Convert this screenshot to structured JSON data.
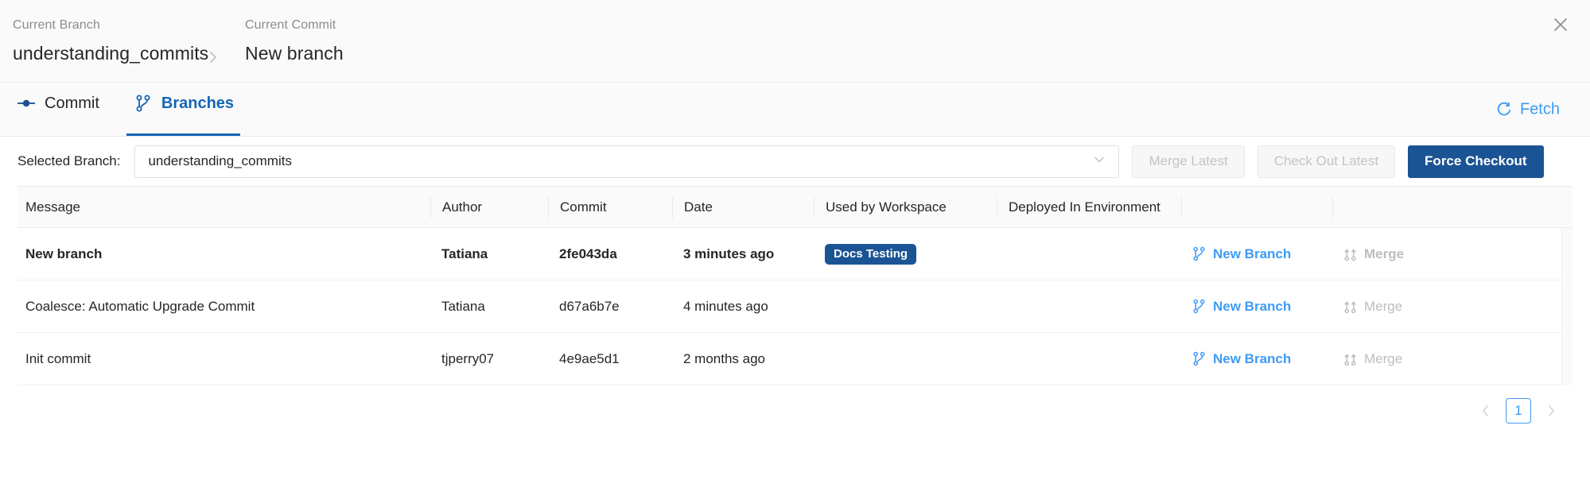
{
  "header": {
    "branch_label": "Current Branch",
    "branch_value": "understanding_commits",
    "commit_label": "Current Commit",
    "commit_value": "New branch",
    "chevron_icon": "chevron-right-icon",
    "close_icon": "close-icon"
  },
  "tabs": [
    {
      "label": "Commit",
      "icon": "commit-dot-icon",
      "active": false
    },
    {
      "label": "Branches",
      "icon": "branch-icon",
      "active": true
    }
  ],
  "fetch": {
    "label": "Fetch",
    "icon": "refresh-icon"
  },
  "controls": {
    "select_label": "Selected Branch:",
    "select_value": "understanding_commits",
    "select_caret_icon": "chevron-down-icon",
    "merge_latest_label": "Merge Latest",
    "check_out_latest_label": "Check Out Latest",
    "force_checkout_label": "Force Checkout"
  },
  "table": {
    "columns": [
      "Message",
      "Author",
      "Commit",
      "Date",
      "Used by Workspace",
      "Deployed In Environment",
      "",
      ""
    ],
    "rows": [
      {
        "message": "New branch",
        "author": "Tatiana",
        "commit": "2fe043da",
        "date": "3 minutes ago",
        "workspace_badge": "Docs Testing",
        "environment": "",
        "new_branch_label": "New Branch",
        "merge_label": "Merge",
        "bold": true
      },
      {
        "message": "Coalesce: Automatic Upgrade Commit",
        "author": "Tatiana",
        "commit": "d67a6b7e",
        "date": "4 minutes ago",
        "workspace_badge": "",
        "environment": "",
        "new_branch_label": "New Branch",
        "merge_label": "Merge",
        "bold": false
      },
      {
        "message": "Init commit",
        "author": "tjperry07",
        "commit": "4e9ae5d1",
        "date": "2 months ago",
        "workspace_badge": "",
        "environment": "",
        "new_branch_label": "New Branch",
        "merge_label": "Merge",
        "bold": false
      }
    ]
  },
  "pagination": {
    "prev_icon": "chevron-left-icon",
    "next_icon": "chevron-right-icon",
    "current_page": "1"
  },
  "colors": {
    "primary_blue": "#1b5494",
    "link_blue": "#3d9bf5",
    "tab_active_blue": "#1565b5",
    "badge_blue": "#1b5494",
    "disabled_grey": "#c4c4c4"
  }
}
